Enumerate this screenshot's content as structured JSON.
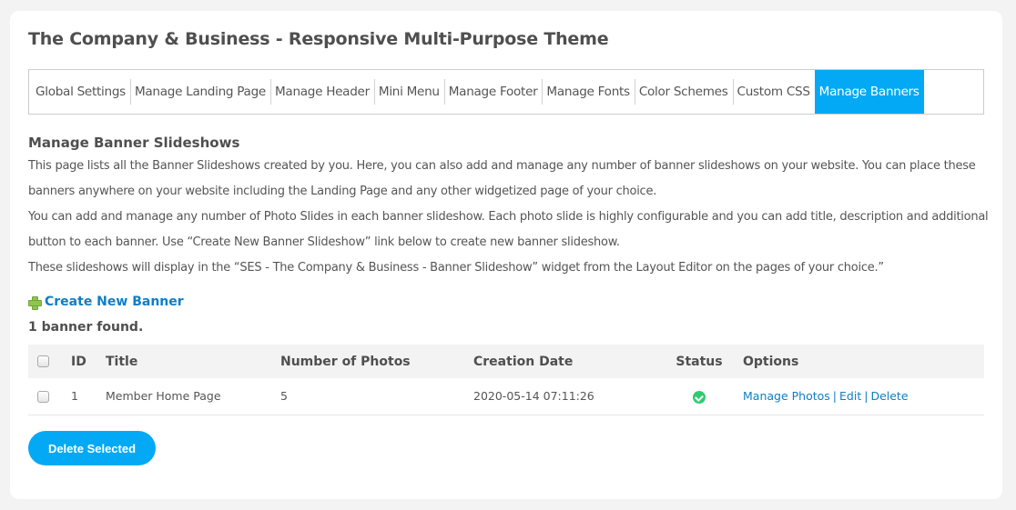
{
  "page": {
    "title": "The Company & Business - Responsive Multi-Purpose Theme"
  },
  "tabs": [
    {
      "label": "Global Settings",
      "active": false
    },
    {
      "label": "Manage Landing Page",
      "active": false
    },
    {
      "label": "Manage Header",
      "active": false
    },
    {
      "label": "Mini Menu",
      "active": false
    },
    {
      "label": "Manage Footer",
      "active": false
    },
    {
      "label": "Manage Fonts",
      "active": false
    },
    {
      "label": "Color Schemes",
      "active": false
    },
    {
      "label": "Custom CSS",
      "active": false
    },
    {
      "label": "Manage Banners",
      "active": true
    }
  ],
  "section": {
    "title": "Manage Banner Slideshows",
    "description": [
      "This page lists all the Banner Slideshows created by you. Here, you can also add and manage any number of banner slideshows on your website. You can place these banners anywhere on your website including the Landing Page and any other widgetized page of your choice.",
      "You can add and manage any number of Photo Slides in each banner slideshow. Each photo slide is highly configurable and you can add title, description and additional button to each banner. Use “Create New Banner Slideshow” link below to create new banner slideshow.",
      "These slideshows will display in the “SES - The Company & Business - Banner Slideshow” widget from the Layout Editor on the pages of your choice.”"
    ],
    "create_link": "Create New Banner",
    "found_text": "1 banner found."
  },
  "table": {
    "headers": {
      "id": "ID",
      "title": "Title",
      "photos": "Number of Photos",
      "date": "Creation Date",
      "status": "Status",
      "options": "Options"
    },
    "rows": [
      {
        "id": "1",
        "title": "Member Home Page",
        "photos": "5",
        "date": "2020-05-14 07:11:26",
        "status": "enabled",
        "options": [
          "Manage Photos",
          "Edit",
          "Delete"
        ]
      }
    ]
  },
  "actions": {
    "delete_selected": "Delete Selected"
  },
  "colors": {
    "accent": "#03a9f4",
    "link": "#0e7ec5",
    "status_ok": "#2ecc71"
  }
}
